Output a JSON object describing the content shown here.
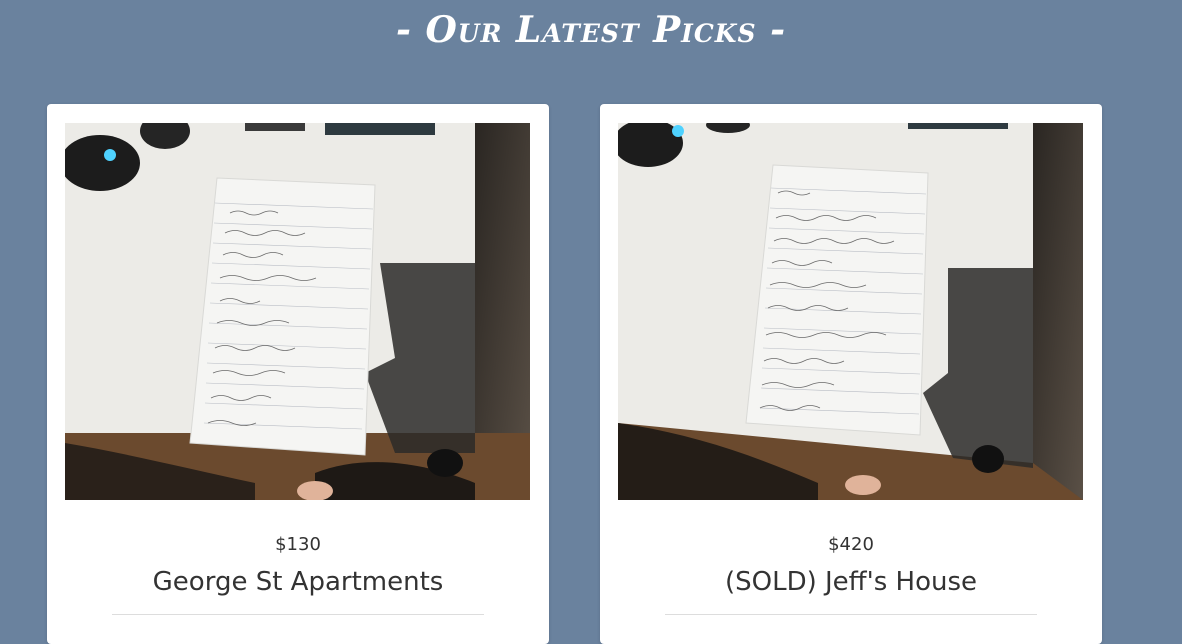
{
  "section": {
    "title": "- Our Latest Picks -"
  },
  "listings": [
    {
      "price": "$130",
      "name": "George St Apartments",
      "photo_icon": "listing-photo"
    },
    {
      "price": "$420",
      "name": "(SOLD) Jeff's House",
      "photo_icon": "listing-photo"
    }
  ]
}
